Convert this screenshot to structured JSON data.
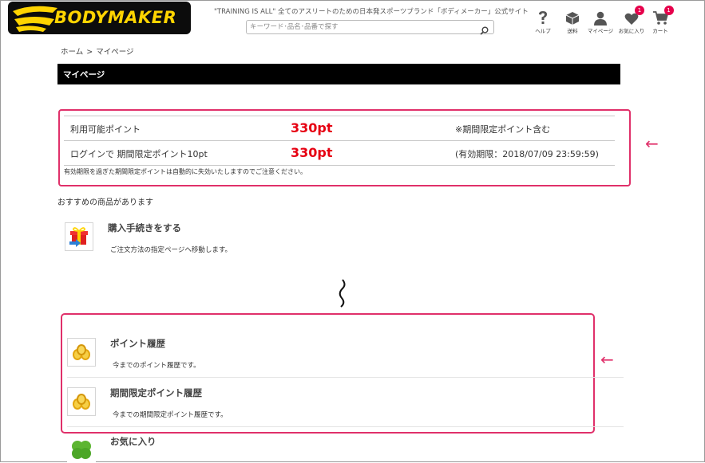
{
  "header": {
    "logo_text": "BODYMAKER",
    "tagline": "\"TRAINING IS ALL\" 全てのアスリートのための日本発スポーツブランド「ボディメーカー」公式サイト",
    "search_placeholder": "キーワード･品名･品番で探す",
    "nav": [
      {
        "label": "ヘルプ",
        "icon": "help-icon"
      },
      {
        "label": "送料",
        "icon": "box-icon"
      },
      {
        "label": "マイページ",
        "icon": "user-icon"
      },
      {
        "label": "お気に入り",
        "icon": "heart-icon",
        "badge": "1"
      },
      {
        "label": "カート",
        "icon": "cart-icon",
        "badge": "1"
      }
    ]
  },
  "breadcrumb": {
    "home": "ホーム",
    "sep": ">",
    "current": "マイページ"
  },
  "page_title": "マイページ",
  "points": {
    "rows": [
      {
        "label": "利用可能ポイント",
        "value": "330pt",
        "note": "※期間限定ポイント含む"
      },
      {
        "label": "ログインで 期間限定ポイント10pt",
        "value": "330pt",
        "note": "(有効期限：2018/07/09 23:59:59)"
      }
    ],
    "warning": "有効期限を過ぎた期間限定ポイントは自動的に失効いたしますのでご注意ください。"
  },
  "annotation_arrow": "←",
  "recommend": {
    "heading": "おすすめの商品があります",
    "items": [
      {
        "title": "購入手続きをする",
        "desc": "ご注文方法の指定ページへ移動します。",
        "icon": "gift-icon"
      }
    ]
  },
  "history": [
    {
      "title": "ポイント履歴",
      "desc": "今までのポイント履歴です。",
      "icon": "coins-icon"
    },
    {
      "title": "期間限定ポイント履歴",
      "desc": "今までの期間限定ポイント履歴です。",
      "icon": "coins-icon"
    }
  ],
  "favorites": {
    "title": "お気に入り",
    "icon": "clover-icon"
  },
  "colors": {
    "accent": "#e0306a",
    "point_value": "#e60012",
    "logo_yellow": "#ffd400"
  }
}
